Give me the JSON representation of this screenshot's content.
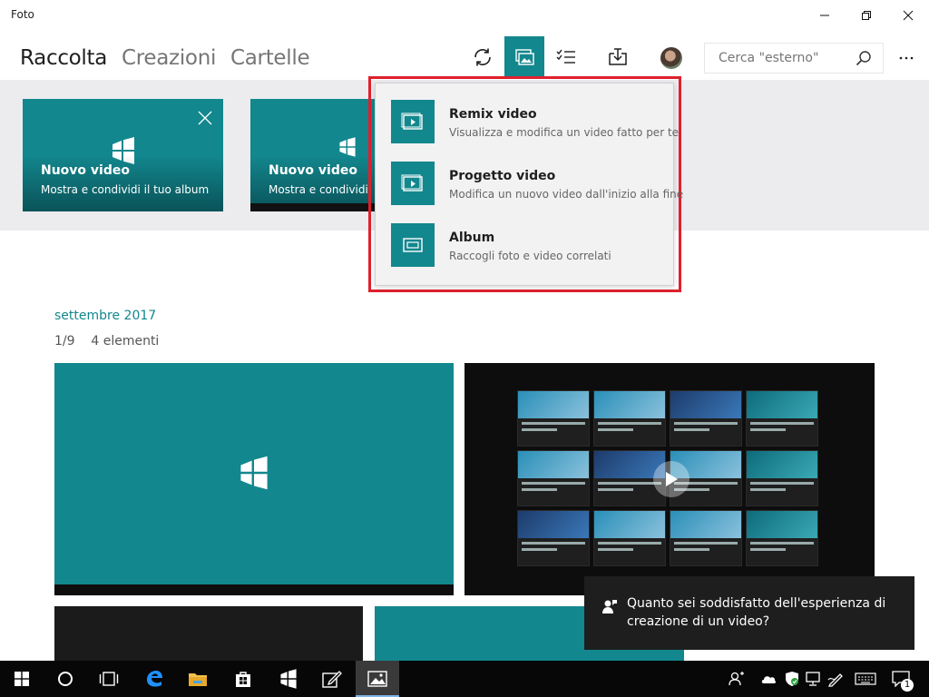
{
  "window": {
    "title": "Foto"
  },
  "nav": {
    "tabs": [
      {
        "label": "Raccolta"
      },
      {
        "label": "Creazioni"
      },
      {
        "label": "Cartelle"
      }
    ]
  },
  "search": {
    "placeholder": "Cerca \"esterno\""
  },
  "banner": {
    "cards": [
      {
        "title": "Nuovo video",
        "subtitle": "Mostra e condividi il tuo album"
      },
      {
        "title": "Nuovo video",
        "subtitle": "Mostra e condividi"
      }
    ]
  },
  "menu": {
    "items": [
      {
        "title": "Remix video",
        "description": "Visualizza e modifica un video fatto per te"
      },
      {
        "title": "Progetto video",
        "description": "Modifica un nuovo video dall'inizio alla fine"
      },
      {
        "title": "Album",
        "description": "Raccogli foto e video correlati"
      }
    ]
  },
  "collection": {
    "date": "settembre 2017",
    "page": "1/9",
    "items": "4 elementi"
  },
  "feedback": {
    "text": "Quanto sei soddisfatto dell'esperienza di creazione di un video?"
  },
  "taskbar": {
    "notification_count": "1"
  },
  "colors": {
    "accent": "#13878e",
    "highlight_outline": "#e0202d"
  }
}
